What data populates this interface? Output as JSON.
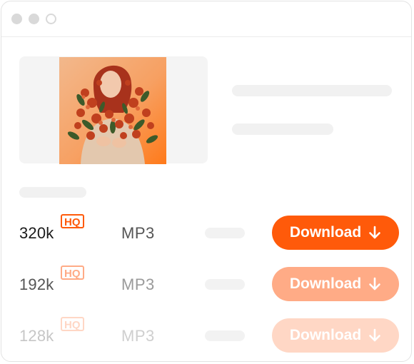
{
  "colors": {
    "accent": "#ff5a0a",
    "accent_mid": "#ffab86",
    "accent_light": "#ffd7c5",
    "text_dark": "#1a1a1a",
    "text_mid": "#555555",
    "text_light": "#c6c6c6"
  },
  "track": {
    "cover_image": "woman-holding-flowers-album-cover"
  },
  "options": [
    {
      "bitrate": "320k",
      "badge": "HQ",
      "format": "MP3",
      "button_label": "Download",
      "button_icon": "arrow-down-icon"
    },
    {
      "bitrate": "192k",
      "badge": "HQ",
      "format": "MP3",
      "button_label": "Download",
      "button_icon": "arrow-down-icon"
    },
    {
      "bitrate": "128k",
      "badge": "HQ",
      "format": "MP3",
      "button_label": "Download",
      "button_icon": "arrow-down-icon"
    }
  ]
}
